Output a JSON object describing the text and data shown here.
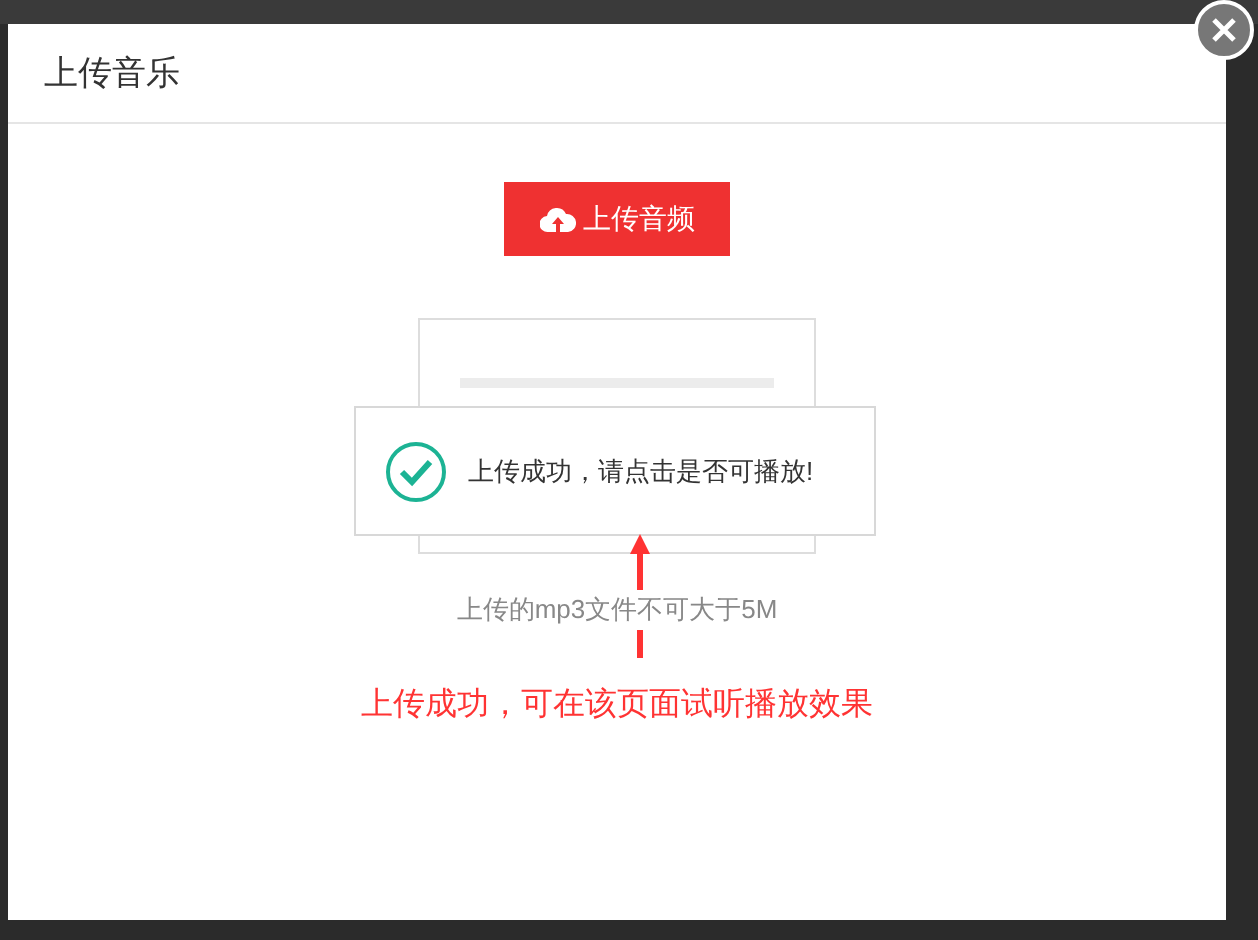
{
  "dialog": {
    "title": "上传音乐",
    "upload_button": "上传音频",
    "toast": "上传成功，请点击是否可播放!",
    "hint": "上传的mp3文件不可大于5M"
  },
  "annotation": {
    "text": "上传成功，可在该页面试听播放效果"
  }
}
